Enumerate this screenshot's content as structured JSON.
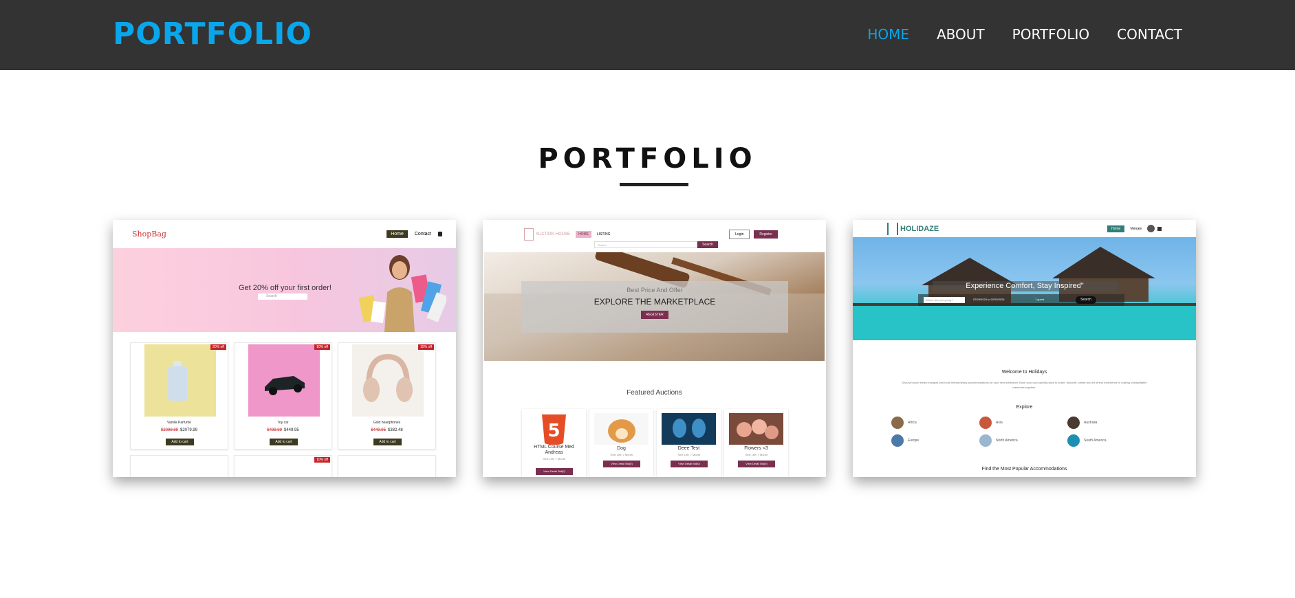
{
  "header": {
    "brand": "PORTFOLIO",
    "nav": [
      "HOME",
      "ABOUT",
      "PORTFOLIO",
      "CONTACT"
    ],
    "active_nav": "HOME"
  },
  "section": {
    "title": "PORTFOLIO"
  },
  "colors": {
    "accent": "#0aa6ec",
    "header_bg": "#333333",
    "auction_accent": "#7a2f4f",
    "holidaze_accent": "#2f7e78",
    "shopbag_dark": "#3d3a1f"
  },
  "shopbag": {
    "logo": "ShopBag",
    "nav": [
      "Home",
      "Contact"
    ],
    "icon": "bag-icon",
    "promo": "Get 20% off your first order!",
    "search_placeholder": "Search",
    "products": [
      {
        "name": "Vanilla Parfume",
        "old_price": "$2099.99",
        "price": "$2079.99",
        "badge": "20% off",
        "cta": "Add to cart"
      },
      {
        "name": "Toy car",
        "old_price": "$499.99",
        "price": "$449.95",
        "badge": "10% off",
        "cta": "Add to cart"
      },
      {
        "name": "Gold headphones",
        "old_price": "$449.95",
        "price": "$382.48",
        "badge": "15% off",
        "cta": "Add to cart"
      }
    ],
    "row2_badge": "10% off"
  },
  "auction": {
    "logo": "AUCTION HOUSE",
    "nav_home": "HOME",
    "nav_listing": "LISTING",
    "login": "Login",
    "register": "Register",
    "search_placeholder": "Search",
    "search_btn": "Search",
    "hero_sub": "Best Price And Offer",
    "hero_title": "EXPLORE THE MARKETPLACE",
    "hero_btn": "REGISTER",
    "featured": "Featured Auctions",
    "items": [
      {
        "name": "HTML Course Med Andreas",
        "time": "Time Left: 7 Month",
        "btn": "View Detail Bid(0)"
      },
      {
        "name": "Dog",
        "time": "Time Left: 7 Month",
        "btn": "View Detail Bid(0)"
      },
      {
        "name": "Deee Test",
        "time": "Time Left: 7 Month",
        "btn": "View Detail Bid(0)"
      },
      {
        "name": "Flowers <3",
        "time": "Time Left: 7 Month",
        "btn": "View Detail Bid(0)"
      }
    ]
  },
  "holidaze": {
    "logo": "HOLIDAZE",
    "nav_home": "Home",
    "nav_venues": "Venues",
    "tagline": "Experience Comfort, Stay Inspired\"",
    "where_placeholder": "Where are you going?",
    "dates": "02/29/2024 to 02/29/2024",
    "guest": "1 guest",
    "search": "Search",
    "welcome": "Welcome to Holidays",
    "description": "Discover your dream escapes and book extraordinary accommodations for your next adventure. Book your own special place to share, discover, create and let others experience it, making unforgettable memories together.",
    "explore": "Explore",
    "regions": [
      "Africa",
      "Asia",
      "Australia",
      "Europe",
      "North America",
      "South America"
    ],
    "popular": "Find the Most Popular Accommodations"
  }
}
